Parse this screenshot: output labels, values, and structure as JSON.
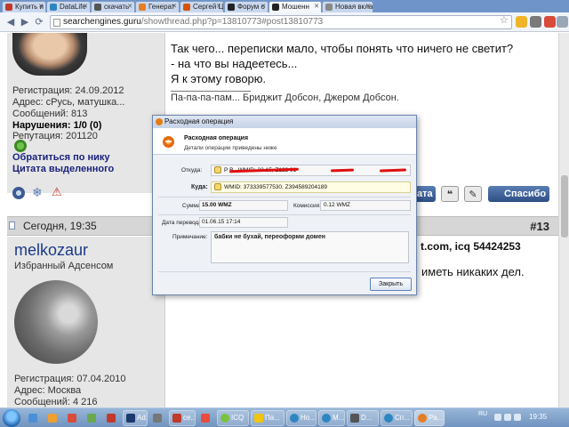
{
  "browser": {
    "tabs": [
      {
        "label": "Купить и",
        "color": "#c0392b"
      },
      {
        "label": "DataLife",
        "color": "#2e86c1"
      },
      {
        "label": "скачать",
        "color": "#555555"
      },
      {
        "label": "Генерат",
        "color": "#e67e22"
      },
      {
        "label": "Сергей Ц",
        "color": "#d35400"
      },
      {
        "label": "Форум о",
        "color": "#222222"
      },
      {
        "label": "Мошенн",
        "color": "#222222"
      },
      {
        "label": "Новая вкла",
        "color": "#888888"
      }
    ],
    "url_host": "searchengines.guru",
    "url_path": "/showthread.php?p=13810773#post13810773"
  },
  "post1": {
    "reg": "Регистрация: 24.09.2012",
    "address": "Адрес: сРусь, матушка...",
    "messages": "Сообщений: 813",
    "violations": "Нарушения: 1/0 (0)",
    "reputation": "Репутация: 201120",
    "link_nick": "Обратиться по нику",
    "link_quote": "Цитата выделенного",
    "line1": "Так чего... переписки мало, чтобы понять что ничего не светит?",
    "line2": "- на что вы надеетесь...",
    "line3": "Я к этому говорю.",
    "signature": "Па-па-па-пам... Бриджит Добсон, Джером Добсон.",
    "btn_quote": "ата",
    "btn_thanks": "Спасибо"
  },
  "post2": {
    "date": "Сегодня, 19:35",
    "number": "#13",
    "username": "melkozaur",
    "title": "Избранный Адсенсом",
    "reg": "Регистрация: 07.04.2010",
    "address": "Адрес: Москва",
    "messages": "Сообщений: 4 216",
    "text_right1": "t.com, icq 54424253",
    "text_right2": "иметь никаких дел."
  },
  "dialog": {
    "window_title": "Расходная операция",
    "header_title": "Расходная операция",
    "header_subtitle": "Детали операции приведены ниже",
    "from_label": "Откуда:",
    "from_value": "Р     В     , WMID: 22      15, Z122          91",
    "to_label": "Куда:",
    "to_value": "WMID: 373339577530, Z394589204189",
    "amount_label": "Сумма:",
    "amount_value": "15.00 WMZ",
    "fee_label": "Комиссия:",
    "fee_value": "0.12 WMZ",
    "date_label": "Дата перевода:",
    "date_value": "01.06.15 17:14",
    "note_label": "Примечание:",
    "note_value": "бабки не бухай, переоформи домен",
    "close_button": "Закрыть"
  },
  "taskbar": {
    "items": [
      {
        "label": "",
        "color": "#4a90d9",
        "pinned": true
      },
      {
        "label": "",
        "color": "#f0a030",
        "pinned": true
      },
      {
        "label": "",
        "color": "#d94c3d",
        "pinned": true
      },
      {
        "label": "",
        "color": "#6aa84f",
        "pinned": true
      },
      {
        "label": "",
        "color": "#c0392b",
        "pinned": true
      },
      {
        "label": "Ad...",
        "color": "#1c3a6e",
        "pinned": false
      },
      {
        "label": "",
        "color": "#777777",
        "pinned": true
      },
      {
        "label": "се...",
        "color": "#c0392b",
        "pinned": false
      },
      {
        "label": "",
        "color": "#e74c3c",
        "pinned": true
      },
      {
        "label": "ICQ",
        "color": "#7cc142",
        "pinned": false
      },
      {
        "label": "Па...",
        "color": "#f1c40f",
        "pinned": false
      },
      {
        "label": "Но...",
        "color": "#2e86c1",
        "pinned": false
      },
      {
        "label": "М...",
        "color": "#2e86c1",
        "pinned": false
      },
      {
        "label": "D...",
        "color": "#555555",
        "pinned": false
      },
      {
        "label": "Сп...",
        "color": "#2e86c1",
        "pinned": false
      },
      {
        "label": "Ра...",
        "color": "#e67e22",
        "pinned": false
      }
    ],
    "lang": "RU",
    "time": "19:35"
  }
}
